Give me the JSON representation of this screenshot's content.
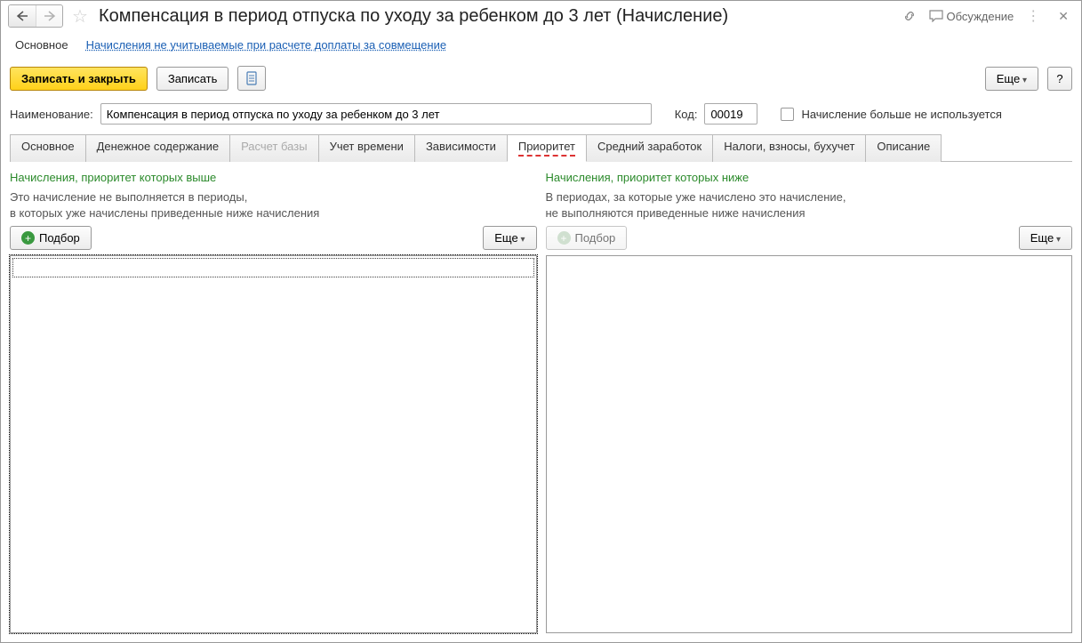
{
  "header": {
    "title": "Компенсация в период отпуска по уходу за ребенком до 3 лет (Начисление)",
    "discussion": "Обсуждение"
  },
  "subnav": {
    "main": "Основное",
    "link": "Начисления не учитываемые при расчете доплаты за совмещение"
  },
  "toolbar": {
    "save_close": "Записать и закрыть",
    "save": "Записать",
    "more": "Еще",
    "help": "?"
  },
  "form": {
    "name_label": "Наименование:",
    "name_value": "Компенсация в период отпуска по уходу за ребенком до 3 лет",
    "code_label": "Код:",
    "code_value": "00019",
    "deprecated_label": "Начисление больше не используется"
  },
  "tabs": [
    {
      "label": "Основное"
    },
    {
      "label": "Денежное содержание"
    },
    {
      "label": "Расчет базы",
      "disabled": true
    },
    {
      "label": "Учет времени"
    },
    {
      "label": "Зависимости"
    },
    {
      "label": "Приоритет",
      "active": true
    },
    {
      "label": "Средний заработок"
    },
    {
      "label": "Налоги, взносы, бухучет"
    },
    {
      "label": "Описание"
    }
  ],
  "panels": {
    "left": {
      "title": "Начисления, приоритет которых выше",
      "desc1": "Это начисление не выполняется в периоды,",
      "desc2": "в которых уже начислены приведенные ниже начисления",
      "pick": "Подбор",
      "more": "Еще"
    },
    "right": {
      "title": "Начисления, приоритет которых ниже",
      "desc1": "В периодах, за которые уже начислено это начисление,",
      "desc2": "не выполняются приведенные ниже начисления",
      "pick": "Подбор",
      "more": "Еще"
    }
  }
}
